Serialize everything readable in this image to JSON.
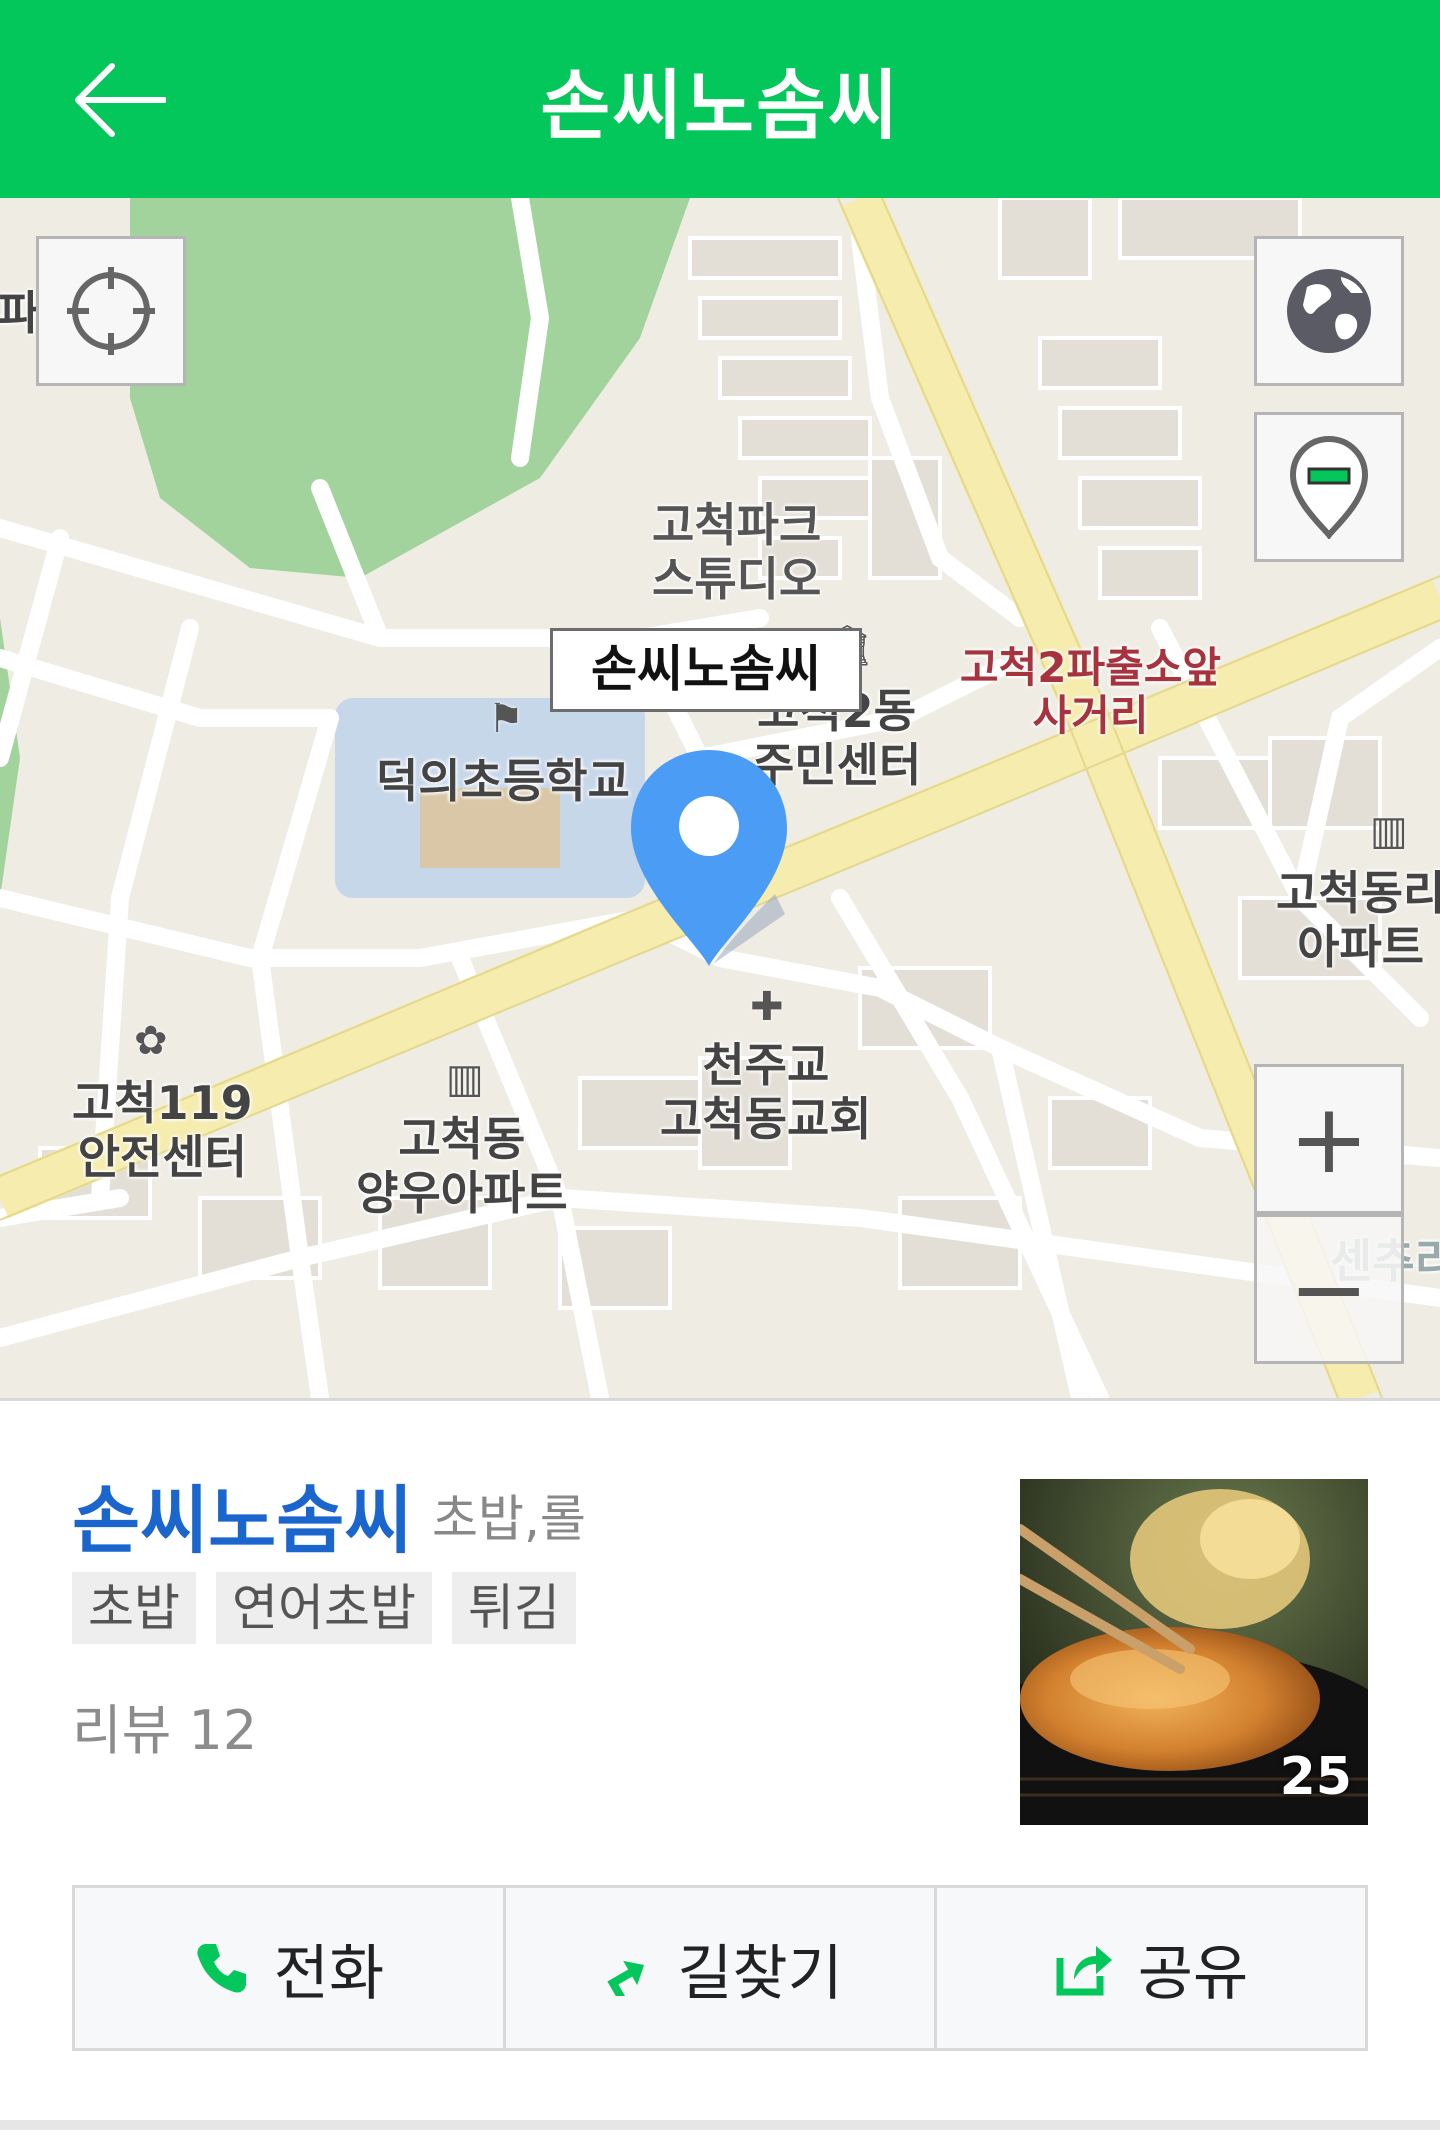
{
  "header": {
    "title": "손씨노솜씨",
    "back_icon": "arrow-left-icon",
    "background": "#03c75a"
  },
  "map": {
    "place_tag": "손씨노솜씨",
    "labels": {
      "school": "덕의초등학교",
      "community_center": "고척2동\n주민센터",
      "police_intersection": "고척2파출소앞\n사거리",
      "fire_station": "고척119\n안전센터",
      "apartment_yangwoo": "고척동\n양우아파트",
      "church": "천주교\n고척동교회",
      "apartment_right": "고척동리\n아파트",
      "park_studio": "고척파크\n스튜디오",
      "left_edge": "파",
      "bottom_right": "센추리"
    },
    "buttons": {
      "locate_icon": "crosshair-icon",
      "layer_icon": "globe-icon",
      "pin_toggle_icon": "map-pin-icon",
      "zoom_in": "+",
      "zoom_out": "−"
    }
  },
  "place": {
    "name": "손씨노솜씨",
    "category": "초밥,롤",
    "tags": [
      "초밥",
      "연어초밥",
      "튀김"
    ],
    "review": "리뷰 12",
    "photo_count": "25"
  },
  "actions": {
    "call": "전화",
    "directions": "길찾기",
    "share": "공유"
  },
  "colors": {
    "accent": "#03c75a",
    "link": "#1a66cc",
    "pin": "#4a9cf5"
  }
}
